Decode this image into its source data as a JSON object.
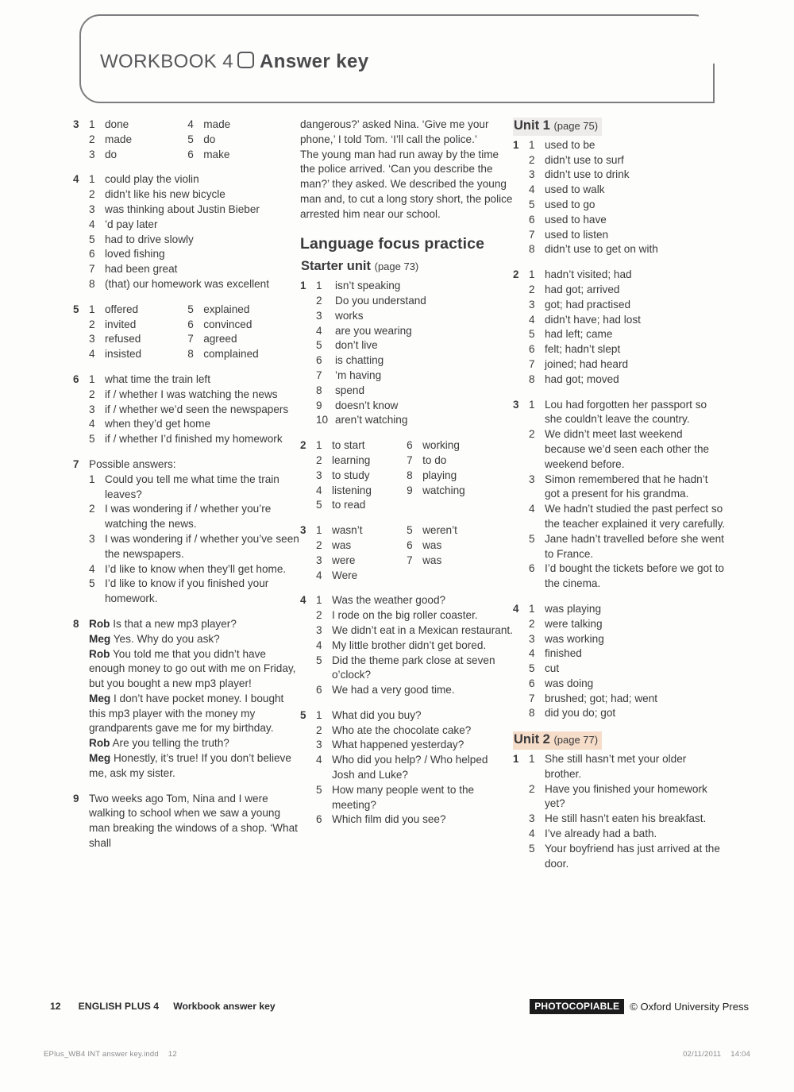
{
  "header": {
    "workbook_label": "WORKBOOK 4",
    "icon": "rounded-square-icon",
    "answer_key_label": "Answer key"
  },
  "columns": {
    "col1": {
      "exercises": [
        {
          "num": "3",
          "layout": "grid2",
          "left": [
            {
              "n": "1",
              "t": "done"
            },
            {
              "n": "2",
              "t": "made"
            },
            {
              "n": "3",
              "t": "do"
            }
          ],
          "right": [
            {
              "n": "4",
              "t": "made"
            },
            {
              "n": "5",
              "t": "do"
            },
            {
              "n": "6",
              "t": "make"
            }
          ]
        },
        {
          "num": "4",
          "layout": "list",
          "items": [
            {
              "n": "1",
              "t": "could play the violin"
            },
            {
              "n": "2",
              "t": "didn’t like his new bicycle"
            },
            {
              "n": "3",
              "t": "was thinking about Justin Bieber"
            },
            {
              "n": "4",
              "t": "’d pay later"
            },
            {
              "n": "5",
              "t": "had to drive slowly"
            },
            {
              "n": "6",
              "t": "loved fishing"
            },
            {
              "n": "7",
              "t": "had been great"
            },
            {
              "n": "8",
              "t": "(that) our homework was excellent"
            }
          ]
        },
        {
          "num": "5",
          "layout": "grid2",
          "left": [
            {
              "n": "1",
              "t": "offered"
            },
            {
              "n": "2",
              "t": "invited"
            },
            {
              "n": "3",
              "t": "refused"
            },
            {
              "n": "4",
              "t": "insisted"
            }
          ],
          "right": [
            {
              "n": "5",
              "t": "explained"
            },
            {
              "n": "6",
              "t": "convinced"
            },
            {
              "n": "7",
              "t": "agreed"
            },
            {
              "n": "8",
              "t": "complained"
            }
          ]
        },
        {
          "num": "6",
          "layout": "list",
          "items": [
            {
              "n": "1",
              "t": "what time the train left"
            },
            {
              "n": "2",
              "t": "if / whether I was watching the news"
            },
            {
              "n": "3",
              "t": "if / whether we’d seen the newspapers"
            },
            {
              "n": "4",
              "t": "when they’d get home"
            },
            {
              "n": "5",
              "t": "if / whether I’d finished my homework"
            }
          ]
        },
        {
          "num": "7",
          "layout": "list",
          "lead": "Possible answers:",
          "items": [
            {
              "n": "1",
              "t": "Could you tell me what time the train leaves?"
            },
            {
              "n": "2",
              "t": "I was wondering if / whether you’re watching the news."
            },
            {
              "n": "3",
              "t": "I was wondering if / whether you’ve seen the newspapers."
            },
            {
              "n": "4",
              "t": "I’d like to know when they’ll get home."
            },
            {
              "n": "5",
              "t": "I’d like to know if you finished your homework."
            }
          ]
        },
        {
          "num": "8",
          "layout": "dialogue",
          "lines": [
            {
              "speaker": "Rob",
              "text": "Is that a new mp3 player?"
            },
            {
              "speaker": "Meg",
              "text": "Yes. Why do you ask?"
            },
            {
              "speaker": "Rob",
              "text": "You told me that you didn’t have enough money to go out with me on Friday, but you bought a new mp3 player!"
            },
            {
              "speaker": "Meg",
              "text": "I don’t have pocket money. I bought this mp3 player with the money my grandparents gave me for my birthday."
            },
            {
              "speaker": "Rob",
              "text": "Are you telling the truth?"
            },
            {
              "speaker": "Meg",
              "text": "Honestly, it’s true! If you don’t believe me, ask my sister."
            }
          ]
        },
        {
          "num": "9",
          "layout": "para",
          "text": "Two weeks ago Tom, Nina and I were walking to school when we saw a young man breaking the windows of a shop. ‘What shall"
        }
      ]
    },
    "col2": {
      "continuation": "dangerous?’ asked Nina. ‘Give me your phone,’ I told Tom. ‘I’ll call the police.’",
      "continuation2": "The young man had run away by the time the police arrived. ‘Can you describe the man?’ they asked. We described the young man and, to cut a long story short, the police arrested him near our school.",
      "section_title": "Language focus practice",
      "unit": {
        "name": "Starter unit",
        "page": "(page 73)",
        "highlight": "none"
      },
      "exercises": [
        {
          "num": "1",
          "layout": "list",
          "wide_numbers": true,
          "items": [
            {
              "n": "1",
              "t": "isn’t speaking"
            },
            {
              "n": "2",
              "t": "Do you understand"
            },
            {
              "n": "3",
              "t": "works"
            },
            {
              "n": "4",
              "t": "are you wearing"
            },
            {
              "n": "5",
              "t": "don’t live"
            },
            {
              "n": "6",
              "t": "is chatting"
            },
            {
              "n": "7",
              "t": "’m having"
            },
            {
              "n": "8",
              "t": "spend"
            },
            {
              "n": "9",
              "t": "doesn’t know"
            },
            {
              "n": "10",
              "t": "aren’t watching"
            }
          ]
        },
        {
          "num": "2",
          "layout": "grid2",
          "left": [
            {
              "n": "1",
              "t": "to start"
            },
            {
              "n": "2",
              "t": "learning"
            },
            {
              "n": "3",
              "t": "to study"
            },
            {
              "n": "4",
              "t": "listening"
            },
            {
              "n": "5",
              "t": "to read"
            }
          ],
          "right": [
            {
              "n": "6",
              "t": "working"
            },
            {
              "n": "7",
              "t": "to do"
            },
            {
              "n": "8",
              "t": "playing"
            },
            {
              "n": "9",
              "t": "watching"
            }
          ]
        },
        {
          "num": "3",
          "layout": "grid2",
          "left": [
            {
              "n": "1",
              "t": "wasn’t"
            },
            {
              "n": "2",
              "t": "was"
            },
            {
              "n": "3",
              "t": "were"
            },
            {
              "n": "4",
              "t": "Were"
            }
          ],
          "right": [
            {
              "n": "5",
              "t": "weren’t"
            },
            {
              "n": "6",
              "t": "was"
            },
            {
              "n": "7",
              "t": "was"
            }
          ]
        },
        {
          "num": "4",
          "layout": "list",
          "items": [
            {
              "n": "1",
              "t": "Was the weather good?"
            },
            {
              "n": "2",
              "t": "I rode on the big roller coaster."
            },
            {
              "n": "3",
              "t": "We didn’t eat in a Mexican restaurant."
            },
            {
              "n": "4",
              "t": "My little brother didn’t get bored."
            },
            {
              "n": "5",
              "t": "Did the theme park close at seven o’clock?"
            },
            {
              "n": "6",
              "t": "We had a very good time."
            }
          ]
        },
        {
          "num": "5",
          "layout": "list",
          "items": [
            {
              "n": "1",
              "t": "What did you buy?"
            },
            {
              "n": "2",
              "t": "Who ate the chocolate cake?"
            },
            {
              "n": "3",
              "t": "What happened yesterday?"
            },
            {
              "n": "4",
              "t": "Who did you help? / Who helped Josh and Luke?"
            },
            {
              "n": "5",
              "t": "How many people went to the meeting?"
            },
            {
              "n": "6",
              "t": "Which film did you see?"
            }
          ]
        }
      ]
    },
    "col3": {
      "units": [
        {
          "name": "Unit 1",
          "page": "(page 75)",
          "highlight": "grey",
          "exercises": [
            {
              "num": "1",
              "layout": "list",
              "items": [
                {
                  "n": "1",
                  "t": "used to be"
                },
                {
                  "n": "2",
                  "t": "didn’t use to surf"
                },
                {
                  "n": "3",
                  "t": "didn’t use to drink"
                },
                {
                  "n": "4",
                  "t": "used to walk"
                },
                {
                  "n": "5",
                  "t": "used to go"
                },
                {
                  "n": "6",
                  "t": "used to have"
                },
                {
                  "n": "7",
                  "t": "used to listen"
                },
                {
                  "n": "8",
                  "t": "didn’t use to get on with"
                }
              ]
            },
            {
              "num": "2",
              "layout": "list",
              "items": [
                {
                  "n": "1",
                  "t": "hadn’t visited; had"
                },
                {
                  "n": "2",
                  "t": "had got; arrived"
                },
                {
                  "n": "3",
                  "t": "got; had practised"
                },
                {
                  "n": "4",
                  "t": "didn’t have; had lost"
                },
                {
                  "n": "5",
                  "t": "had left; came"
                },
                {
                  "n": "6",
                  "t": "felt; hadn’t slept"
                },
                {
                  "n": "7",
                  "t": "joined; had heard"
                },
                {
                  "n": "8",
                  "t": "had got; moved"
                }
              ]
            },
            {
              "num": "3",
              "layout": "list",
              "items": [
                {
                  "n": "1",
                  "t": "Lou had forgotten her passport so she couldn’t leave the country."
                },
                {
                  "n": "2",
                  "t": "We didn’t meet last weekend because we’d seen each other the weekend before."
                },
                {
                  "n": "3",
                  "t": "Simon remembered that he hadn’t got a present for his grandma."
                },
                {
                  "n": "4",
                  "t": "We hadn’t studied the past perfect so the teacher explained it very carefully."
                },
                {
                  "n": "5",
                  "t": "Jane hadn’t travelled before she went to France."
                },
                {
                  "n": "6",
                  "t": "I’d bought the tickets before we got to the cinema."
                }
              ]
            },
            {
              "num": "4",
              "layout": "list",
              "items": [
                {
                  "n": "1",
                  "t": "was playing"
                },
                {
                  "n": "2",
                  "t": "were talking"
                },
                {
                  "n": "3",
                  "t": "was working"
                },
                {
                  "n": "4",
                  "t": "finished"
                },
                {
                  "n": "5",
                  "t": "cut"
                },
                {
                  "n": "6",
                  "t": "was doing"
                },
                {
                  "n": "7",
                  "t": "brushed; got; had; went"
                },
                {
                  "n": "8",
                  "t": "did you do; got"
                }
              ]
            }
          ]
        },
        {
          "name": "Unit 2",
          "page": "(page 77)",
          "highlight": "peach",
          "exercises": [
            {
              "num": "1",
              "layout": "list",
              "items": [
                {
                  "n": "1",
                  "t": "She still hasn’t met your older brother."
                },
                {
                  "n": "2",
                  "t": "Have you finished your homework yet?"
                },
                {
                  "n": "3",
                  "t": "He still hasn’t eaten his breakfast."
                },
                {
                  "n": "4",
                  "t": "I’ve already had a bath."
                },
                {
                  "n": "5",
                  "t": "Your boyfriend has just arrived at the door."
                }
              ]
            }
          ]
        }
      ]
    }
  },
  "footer": {
    "page_number": "12",
    "series": "ENGLISH PLUS 4",
    "subtitle": "Workbook answer key",
    "photocopiable": "PHOTOCOPIABLE",
    "copyright": "© Oxford University Press"
  },
  "printmarks": {
    "file": "EPlus_WB4 INT answer key.indd",
    "file_page": "12",
    "date": "02/11/2011",
    "time": "14:04"
  },
  "colors": {
    "text": "#3a3a3c",
    "rule": "#7d7d80",
    "highlight_grey": "#eeecea",
    "highlight_peach": "#f6ddc9",
    "photocopiable_bg": "#1c1c1c"
  }
}
